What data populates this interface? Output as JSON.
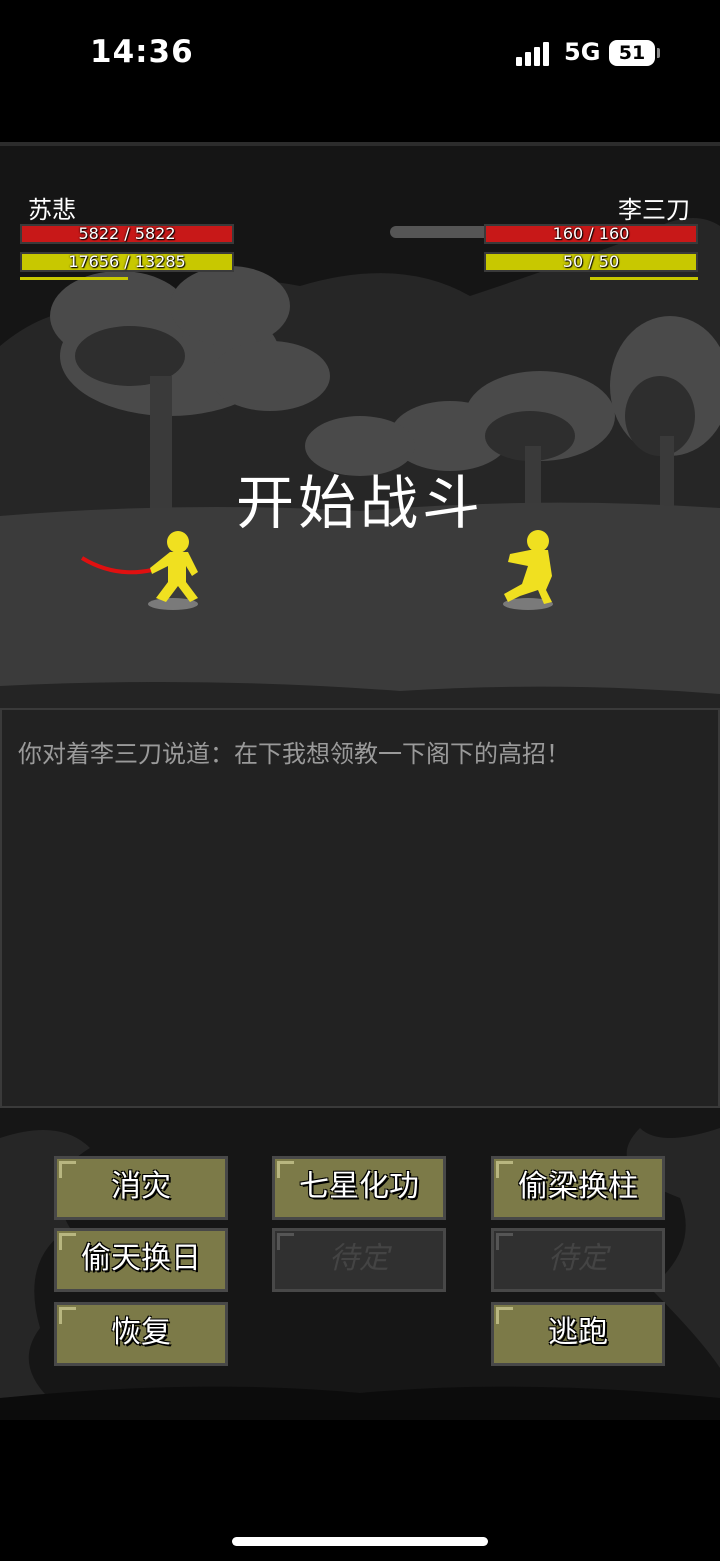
{
  "status_bar": {
    "time": "14:36",
    "network": "5G",
    "battery": "51"
  },
  "player": {
    "name": "苏悲",
    "hp_text": "5822 / 5822",
    "hp_fraction": 1.0,
    "mp_text": "17656 / 13285",
    "mp_fraction": 1.0
  },
  "enemy": {
    "name": "李三刀",
    "hp_text": "160 / 160",
    "hp_fraction": 1.0,
    "mp_text": "50 / 50",
    "mp_fraction": 1.0
  },
  "battle": {
    "banner": "开始战斗"
  },
  "log": {
    "lines": [
      "你对着李三刀说道：在下我想领教一下阁下的高招！"
    ]
  },
  "actions": {
    "skill_1": "消灾",
    "skill_2": "七星化功",
    "skill_3": "偷梁换柱",
    "skill_4": "偷天换日",
    "skill_5": "待定",
    "skill_6": "待定",
    "recover": "恢复",
    "flee": "逃跑"
  },
  "colors": {
    "hp": "#c81818",
    "mp": "#c8c800",
    "button": "#7c7a48",
    "fighter": "#f0e020",
    "sword": "#e01010"
  }
}
